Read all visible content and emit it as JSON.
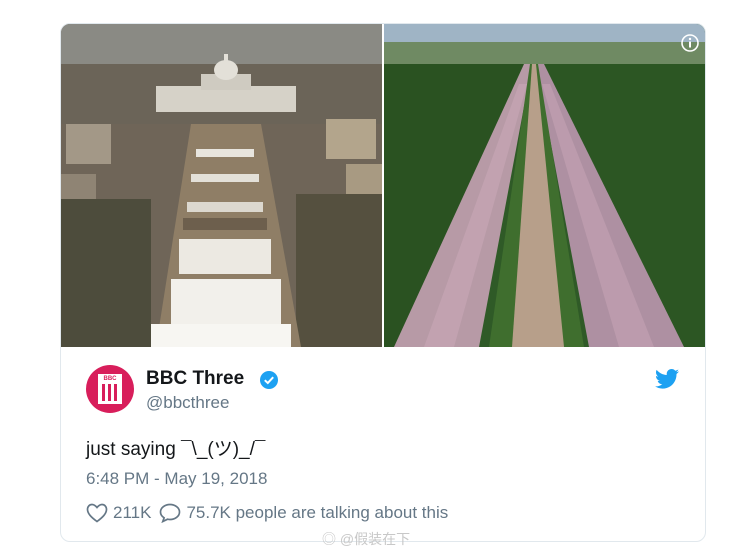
{
  "tweet": {
    "display_name": "BBC Three",
    "handle": "@bbcthree",
    "text": "just saying ¯\\_(ツ)_/¯",
    "timestamp": "6:48 PM - May 19, 2018",
    "likes": "211K",
    "replies_text": "75.7K people are talking about this",
    "verified": true
  },
  "avatar": {
    "logo_text": "BBC"
  },
  "media": {
    "images": [
      {
        "name": "washington-mall-crowd-photo"
      },
      {
        "name": "windsor-long-walk-crowd-photo"
      }
    ]
  },
  "watermark": {
    "text": "@假装在下"
  },
  "colors": {
    "twitter_blue": "#1da1f2",
    "bbc_three_pink": "#d81e5b",
    "text_primary": "#14171a",
    "text_secondary": "#657786"
  }
}
